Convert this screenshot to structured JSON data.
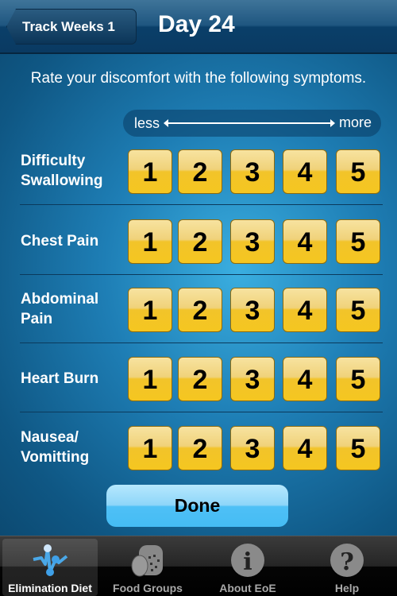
{
  "nav": {
    "back_label": "Track Weeks 1",
    "title": "Day 24"
  },
  "instruction": "Rate your discomfort with the following symptoms.",
  "scale": {
    "less": "less",
    "more": "more"
  },
  "symptoms": [
    {
      "label": "Difficulty Swallowing",
      "ratings": [
        "1",
        "2",
        "3",
        "4",
        "5"
      ]
    },
    {
      "label": "Chest Pain",
      "ratings": [
        "1",
        "2",
        "3",
        "4",
        "5"
      ]
    },
    {
      "label": "Abdominal Pain",
      "ratings": [
        "1",
        "2",
        "3",
        "4",
        "5"
      ]
    },
    {
      "label": "Heart Burn",
      "ratings": [
        "1",
        "2",
        "3",
        "4",
        "5"
      ]
    },
    {
      "label": "Nausea/ Vomitting",
      "ratings": [
        "1",
        "2",
        "3",
        "4",
        "5"
      ]
    }
  ],
  "done_label": "Done",
  "tabs": [
    {
      "label": "Elimination Diet",
      "icon": "chart-line-icon",
      "active": true
    },
    {
      "label": "Food Groups",
      "icon": "bread-icon",
      "active": false
    },
    {
      "label": "About EoE",
      "icon": "info-icon",
      "active": false
    },
    {
      "label": "Help",
      "icon": "help-icon",
      "active": false
    }
  ],
  "colors": {
    "rating_button": "#f2c42a",
    "done_button": "#4ec0f6",
    "active_tab_icon": "#4aa8e8"
  }
}
